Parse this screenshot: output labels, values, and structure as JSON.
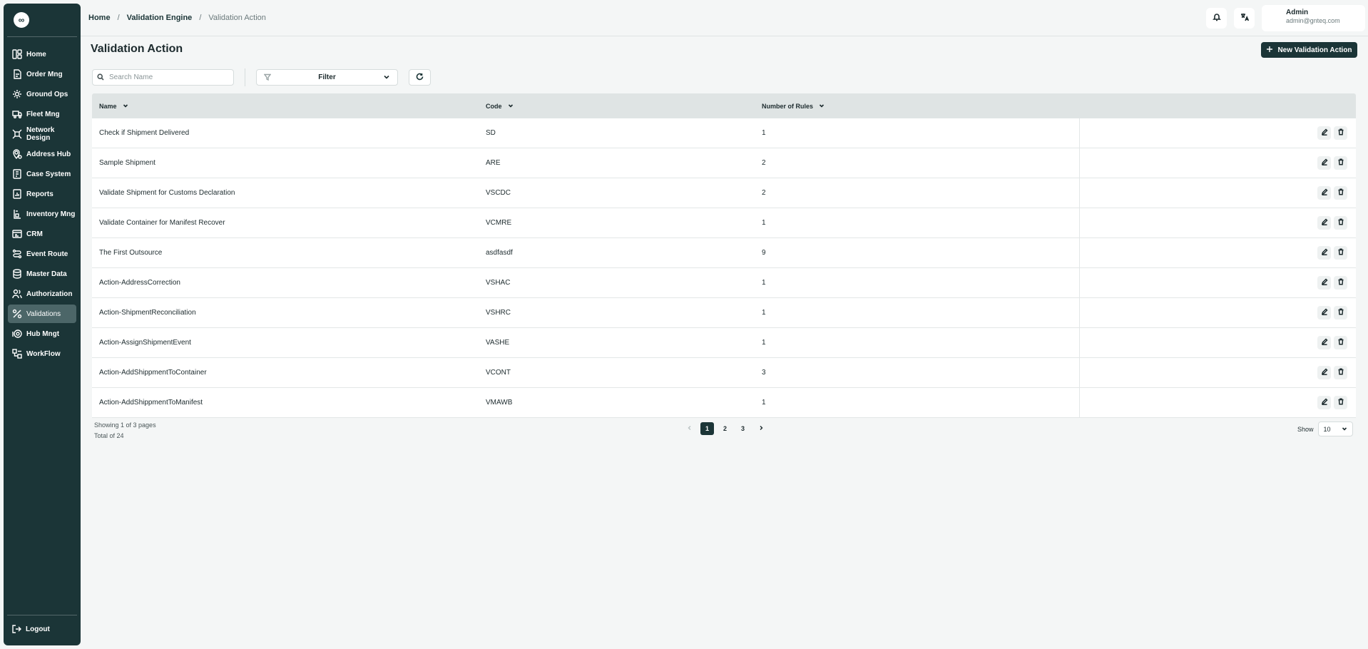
{
  "sidebar": {
    "logo": "∞",
    "items": [
      {
        "label": "Home",
        "icon": "home-icon"
      },
      {
        "label": "Order Mng",
        "icon": "order-icon"
      },
      {
        "label": "Ground Ops",
        "icon": "ground-ops-icon"
      },
      {
        "label": "Fleet Mng",
        "icon": "truck-icon"
      },
      {
        "label": "Network Design",
        "icon": "network-icon"
      },
      {
        "label": "Address Hub",
        "icon": "location-icon"
      },
      {
        "label": "Case System",
        "icon": "case-icon"
      },
      {
        "label": "Reports",
        "icon": "report-icon"
      },
      {
        "label": "Inventory Mng",
        "icon": "inventory-icon"
      },
      {
        "label": "CRM",
        "icon": "crm-icon"
      },
      {
        "label": "Event Route",
        "icon": "route-icon"
      },
      {
        "label": "Master Data",
        "icon": "database-icon"
      },
      {
        "label": "Authorization",
        "icon": "users-icon"
      },
      {
        "label": "Validations",
        "icon": "validation-icon",
        "active": true
      },
      {
        "label": "Hub Mngt",
        "icon": "hub-icon"
      },
      {
        "label": "WorkFlow",
        "icon": "workflow-icon"
      }
    ],
    "logout": "Logout"
  },
  "header": {
    "breadcrumb": [
      "Home",
      "Validation Engine",
      "Validation Action"
    ],
    "user": {
      "name": "Admin",
      "email": "admin@gnteq.com"
    }
  },
  "main": {
    "title": "Validation Action",
    "new_button": "New Validation Action",
    "search_placeholder": "Search Name",
    "filter_label": "Filter"
  },
  "table": {
    "columns": [
      "Name",
      "Code",
      "Number of Rules"
    ],
    "rows": [
      {
        "name": "Check if Shipment Delivered",
        "code": "SD",
        "rules": "1"
      },
      {
        "name": "Sample Shipment",
        "code": "ARE",
        "rules": "2"
      },
      {
        "name": "Validate Shipment for Customs Declaration",
        "code": "VSCDC",
        "rules": "2"
      },
      {
        "name": "Validate Container for Manifest Recover",
        "code": "VCMRE",
        "rules": "1"
      },
      {
        "name": "The First Outsource",
        "code": "asdfasdf",
        "rules": "9"
      },
      {
        "name": "Action-AddressCorrection",
        "code": "VSHAC",
        "rules": "1"
      },
      {
        "name": "Action-ShipmentReconciliation",
        "code": "VSHRC",
        "rules": "1"
      },
      {
        "name": "Action-AssignShipmentEvent",
        "code": "VASHE",
        "rules": "1"
      },
      {
        "name": "Action-AddShippmentToContainer",
        "code": "VCONT",
        "rules": "3"
      },
      {
        "name": "Action-AddShippmentToManifest",
        "code": "VMAWB",
        "rules": "1"
      }
    ]
  },
  "footer": {
    "showing": "Showing 1 of 3 pages",
    "total": "Total of 24",
    "pages": [
      "1",
      "2",
      "3"
    ],
    "current_page": "1",
    "show_label": "Show",
    "page_size": "10"
  },
  "colors": {
    "primary": "#1b3537",
    "active_nav": "#4c6668",
    "table_header": "#dfe4e4",
    "background": "#f4f6f6"
  }
}
